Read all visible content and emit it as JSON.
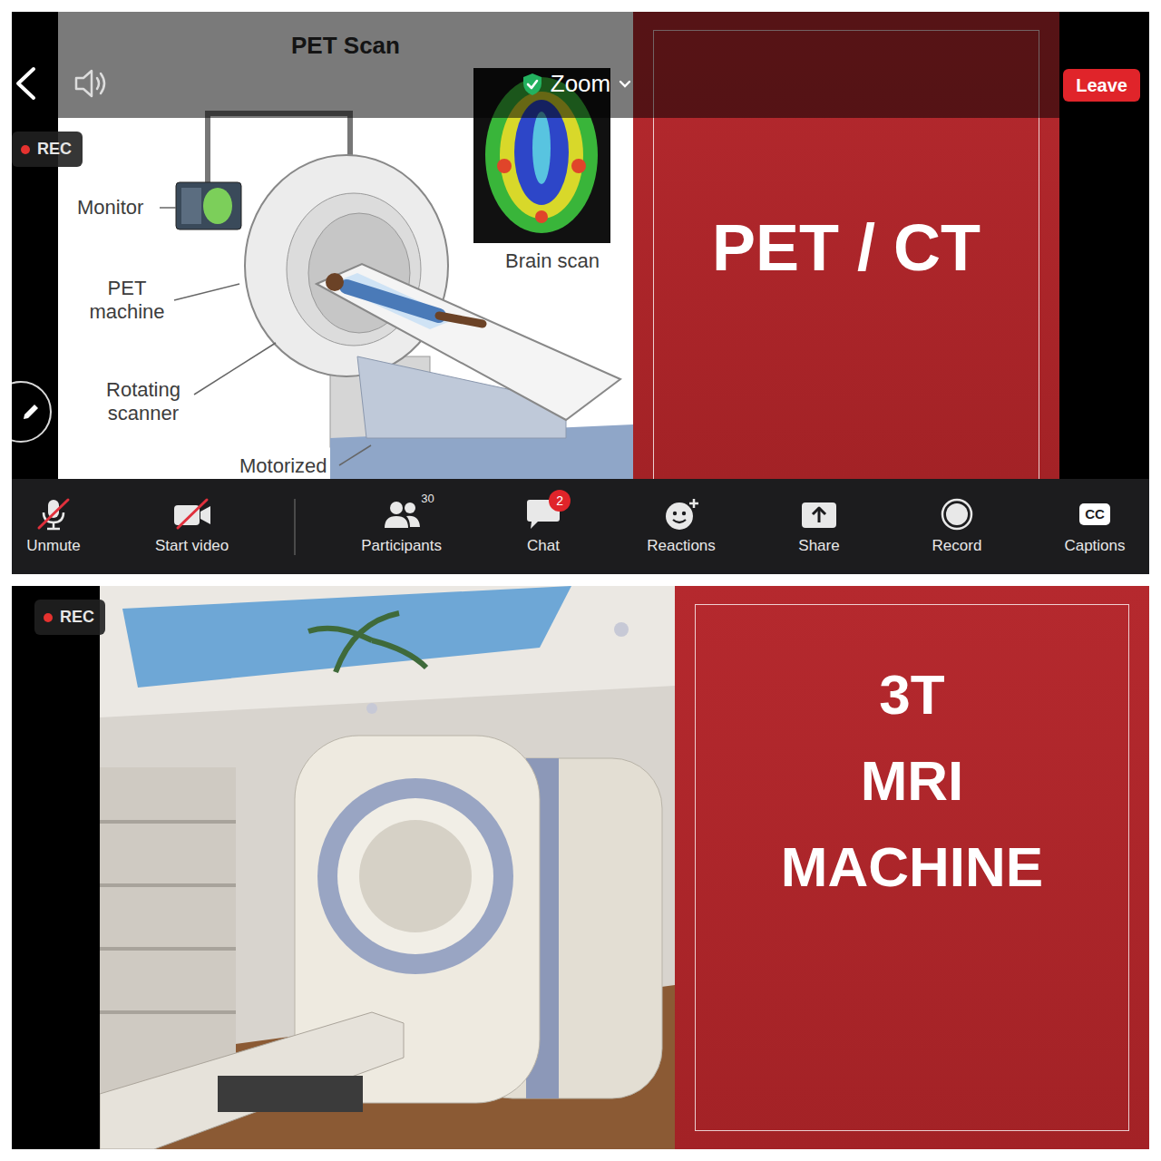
{
  "zoom_window": {
    "top_bar": {
      "app_name": "Zoom",
      "leave_button": "Leave"
    },
    "recording_badge": {
      "label": "REC",
      "recording": true
    },
    "shared_slide": {
      "diagram": {
        "title": "PET Scan",
        "labels": [
          "Monitor",
          "PET machine",
          "Rotating scanner",
          "Motorized"
        ],
        "inset_caption": "Brain scan"
      },
      "heading": "PET / CT"
    },
    "toolbar": [
      {
        "label": "Unmute",
        "muted": true
      },
      {
        "label": "Start video",
        "video_on": false
      },
      {
        "label": "Participants",
        "count": "30"
      },
      {
        "label": "Chat",
        "badge": "2"
      },
      {
        "label": "Reactions"
      },
      {
        "label": "Share"
      },
      {
        "label": "Record"
      },
      {
        "label": "Captions",
        "glyph": "CC"
      }
    ]
  },
  "second_window": {
    "recording_badge": {
      "label": "REC",
      "recording": true
    },
    "shared_slide": {
      "heading_lines": [
        "3T",
        "MRI",
        "MACHINE"
      ]
    }
  }
}
